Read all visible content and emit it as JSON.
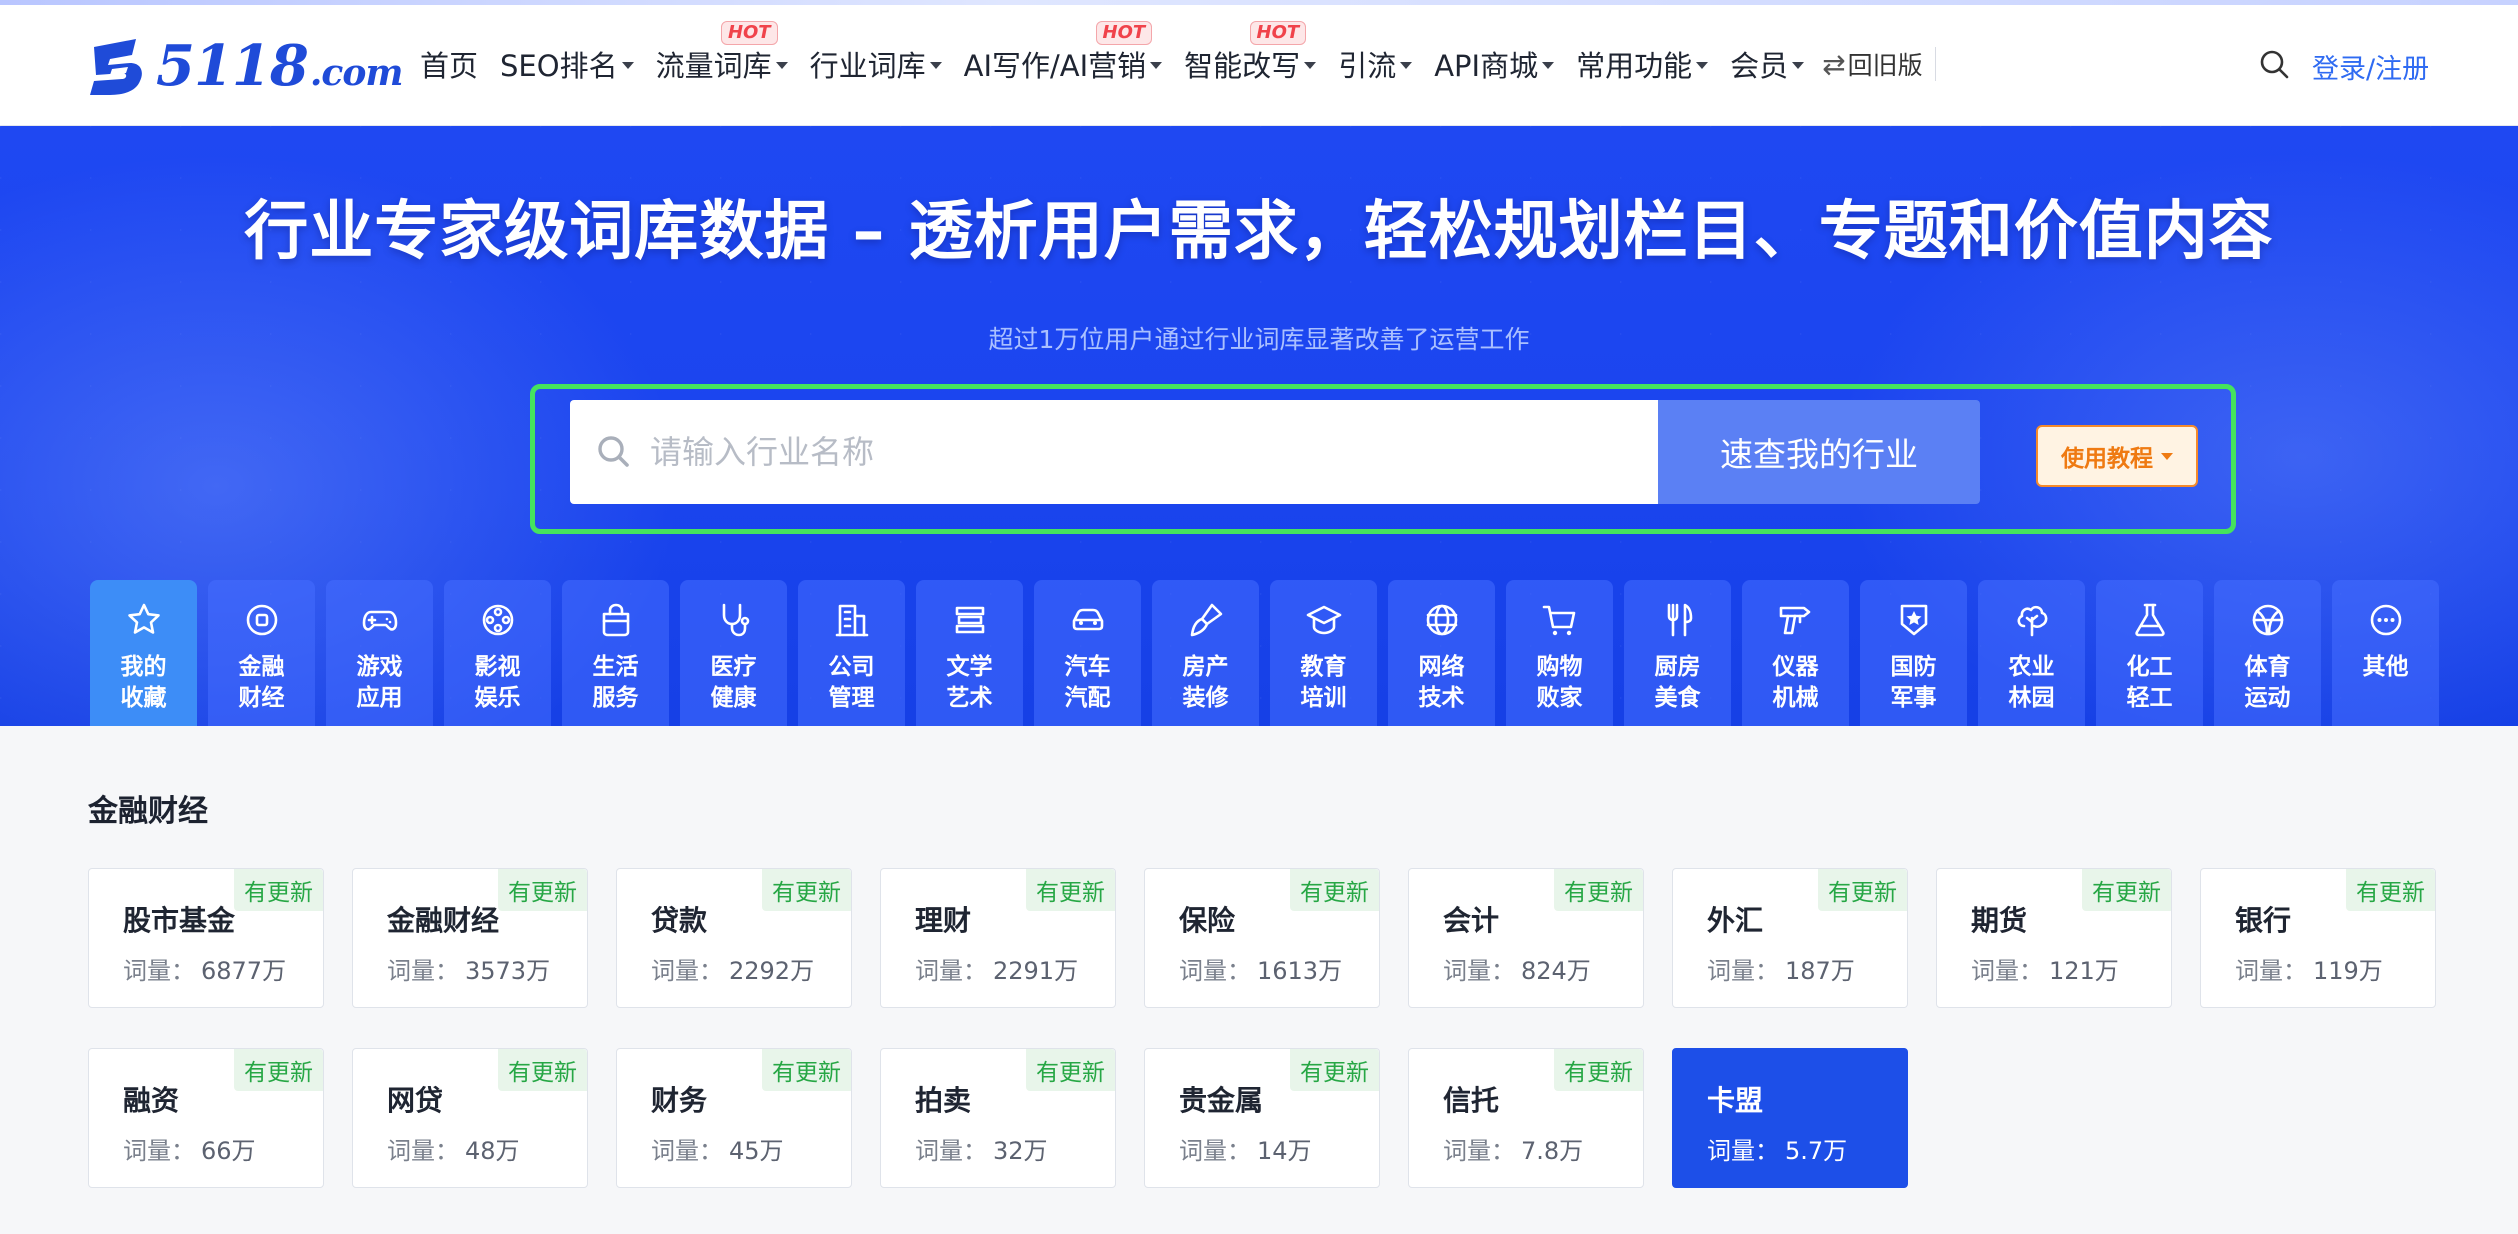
{
  "header": {
    "logo_text": "5118",
    "logo_suffix": ".com",
    "nav": [
      {
        "label": "首页",
        "caret": false,
        "hot": false
      },
      {
        "label": "SEO排名",
        "caret": true,
        "hot": false
      },
      {
        "label": "流量词库",
        "caret": true,
        "hot": true
      },
      {
        "label": "行业词库",
        "caret": true,
        "hot": false
      },
      {
        "label": "AI写作/AI营销",
        "caret": true,
        "hot": true
      },
      {
        "label": "智能改写",
        "caret": true,
        "hot": true
      },
      {
        "label": "引流",
        "caret": true,
        "hot": false
      },
      {
        "label": "API商城",
        "caret": true,
        "hot": false
      },
      {
        "label": "常用功能",
        "caret": true,
        "hot": false
      },
      {
        "label": "会员",
        "caret": true,
        "hot": false
      }
    ],
    "hot_label": "HOT",
    "old_version": "回旧版",
    "login": "登录/注册"
  },
  "hero": {
    "title": "行业专家级词库数据 – 透析用户需求，轻松规划栏目、专题和价值内容",
    "subtitle": "超过1万位用户通过行业词库显著改善了运营工作",
    "search_placeholder": "请输入行业名称",
    "search_value": "",
    "search_button": "速查我的行业",
    "tutorial_button": "使用教程"
  },
  "categories": [
    {
      "label": "我的收藏",
      "icon": "star-icon",
      "active": true
    },
    {
      "label": "金融财经",
      "icon": "finance-icon",
      "active": false
    },
    {
      "label": "游戏应用",
      "icon": "gamepad-icon",
      "active": false
    },
    {
      "label": "影视娱乐",
      "icon": "film-reel-icon",
      "active": false
    },
    {
      "label": "生活服务",
      "icon": "bag-icon",
      "active": false
    },
    {
      "label": "医疗健康",
      "icon": "stethoscope-icon",
      "active": false
    },
    {
      "label": "公司管理",
      "icon": "building-icon",
      "active": false
    },
    {
      "label": "文学艺术",
      "icon": "books-icon",
      "active": false
    },
    {
      "label": "汽车汽配",
      "icon": "car-icon",
      "active": false
    },
    {
      "label": "房产装修",
      "icon": "brush-icon",
      "active": false
    },
    {
      "label": "教育培训",
      "icon": "graduation-cap-icon",
      "active": false
    },
    {
      "label": "网络技术",
      "icon": "globe-icon",
      "active": false
    },
    {
      "label": "购物败家",
      "icon": "cart-icon",
      "active": false
    },
    {
      "label": "厨房美食",
      "icon": "utensils-icon",
      "active": false
    },
    {
      "label": "仪器机械",
      "icon": "drill-icon",
      "active": false
    },
    {
      "label": "国防军事",
      "icon": "military-badge-icon",
      "active": false
    },
    {
      "label": "农业林园",
      "icon": "tree-icon",
      "active": false
    },
    {
      "label": "化工轻工",
      "icon": "flask-icon",
      "active": false
    },
    {
      "label": "体育运动",
      "icon": "ball-icon",
      "active": false
    },
    {
      "label": "其他",
      "icon": "more-icon",
      "active": false
    }
  ],
  "section": {
    "title": "金融财经",
    "volume_label": "词量：",
    "update_badge": "有更新",
    "cards": [
      {
        "name": "股市基金",
        "volume": "6877万",
        "updated": true,
        "selected": false
      },
      {
        "name": "金融财经",
        "volume": "3573万",
        "updated": true,
        "selected": false
      },
      {
        "name": "贷款",
        "volume": "2292万",
        "updated": true,
        "selected": false
      },
      {
        "name": "理财",
        "volume": "2291万",
        "updated": true,
        "selected": false
      },
      {
        "name": "保险",
        "volume": "1613万",
        "updated": true,
        "selected": false
      },
      {
        "name": "会计",
        "volume": "824万",
        "updated": true,
        "selected": false
      },
      {
        "name": "外汇",
        "volume": "187万",
        "updated": true,
        "selected": false
      },
      {
        "name": "期货",
        "volume": "121万",
        "updated": true,
        "selected": false
      },
      {
        "name": "银行",
        "volume": "119万",
        "updated": true,
        "selected": false
      },
      {
        "name": "融资",
        "volume": "66万",
        "updated": true,
        "selected": false
      },
      {
        "name": "网贷",
        "volume": "48万",
        "updated": true,
        "selected": false
      },
      {
        "name": "财务",
        "volume": "45万",
        "updated": true,
        "selected": false
      },
      {
        "name": "拍卖",
        "volume": "32万",
        "updated": true,
        "selected": false
      },
      {
        "name": "贵金属",
        "volume": "14万",
        "updated": true,
        "selected": false
      },
      {
        "name": "信托",
        "volume": "7.8万",
        "updated": true,
        "selected": false
      },
      {
        "name": "卡盟",
        "volume": "5.7万",
        "updated": false,
        "selected": true
      }
    ]
  },
  "colors": {
    "brand": "#1f4bd8",
    "hero_bg": "#1f48f2",
    "search_frame": "#45e35e",
    "search_button": "#5b80f4",
    "badge_text": "#27a745",
    "selected_card": "#1d4fe8",
    "tutorial": "#ef7a12"
  }
}
